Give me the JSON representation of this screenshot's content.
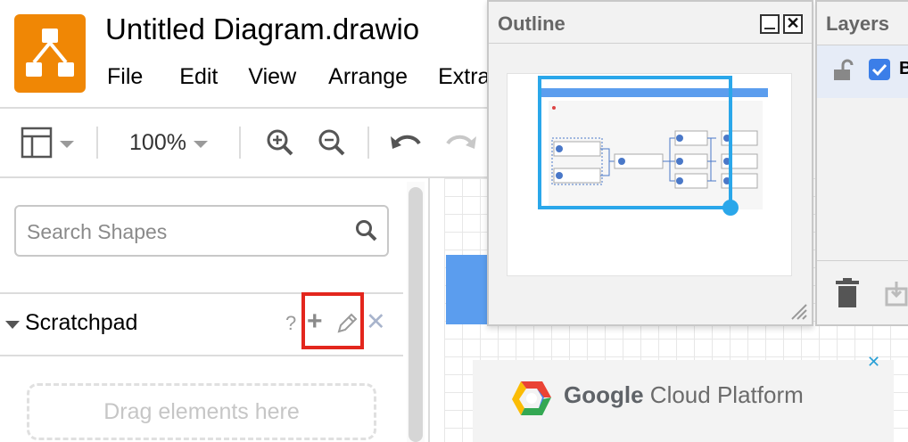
{
  "header": {
    "title": "Untitled Diagram.drawio",
    "menu": [
      "File",
      "Edit",
      "View",
      "Arrange",
      "Extras"
    ]
  },
  "toolbar": {
    "zoom_level": "100%",
    "icons": [
      "panel-layout-icon",
      "zoom-in-icon",
      "zoom-out-icon",
      "undo-icon",
      "redo-icon"
    ]
  },
  "sidebar": {
    "search_placeholder": "Search Shapes",
    "scratchpad": {
      "title": "Scratchpad",
      "help": "?",
      "add": "+",
      "close": "✕",
      "drop_text": "Drag elements here"
    }
  },
  "outline": {
    "title": "Outline",
    "close": "✕"
  },
  "layers": {
    "title": "Layers",
    "layer_name": "B"
  },
  "ad": {
    "brand": "Google",
    "product": "Cloud Platform",
    "close": "✕"
  },
  "colors": {
    "logo": "#f08705",
    "highlight": "#e3261d",
    "viewport": "#2aa7ea",
    "checkbox": "#3b7ee8"
  }
}
